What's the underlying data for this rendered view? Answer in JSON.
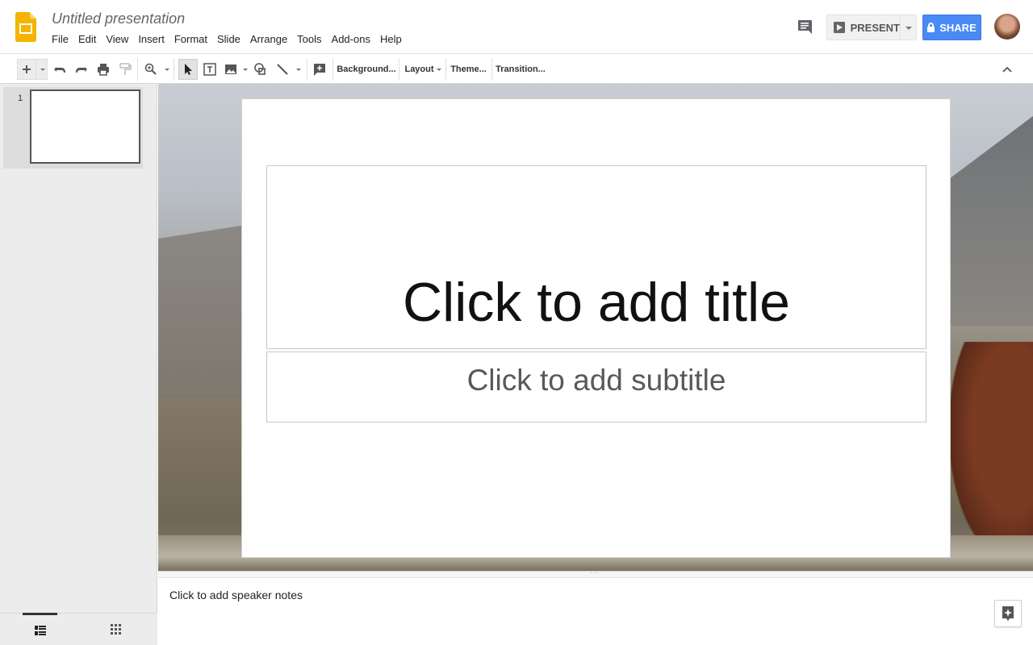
{
  "header": {
    "doc_title": "Untitled presentation",
    "menu": [
      "File",
      "Edit",
      "View",
      "Insert",
      "Format",
      "Slide",
      "Arrange",
      "Tools",
      "Add-ons",
      "Help"
    ],
    "present_label": "PRESENT",
    "share_label": "SHARE"
  },
  "toolbar": {
    "background_label": "Background...",
    "layout_label": "Layout",
    "theme_label": "Theme...",
    "transition_label": "Transition..."
  },
  "filmstrip": {
    "slides": [
      {
        "number": "1"
      }
    ]
  },
  "slide": {
    "title_placeholder": "Click to add title",
    "subtitle_placeholder": "Click to add subtitle"
  },
  "notes": {
    "placeholder": "Click to add speaker notes"
  },
  "colors": {
    "share_blue": "#4a8af4",
    "slides_yellow": "#f4b400"
  },
  "icons": [
    "slides-logo-icon",
    "comment-icon",
    "present-icon",
    "lock-icon",
    "avatar",
    "new-slide-icon",
    "undo-icon",
    "redo-icon",
    "print-icon",
    "paint-format-icon",
    "zoom-icon",
    "select-icon",
    "text-box-icon",
    "image-icon",
    "shape-icon",
    "line-icon",
    "comment-add-icon",
    "collapse-icon",
    "list-view-icon",
    "grid-view-icon",
    "explore-icon"
  ]
}
